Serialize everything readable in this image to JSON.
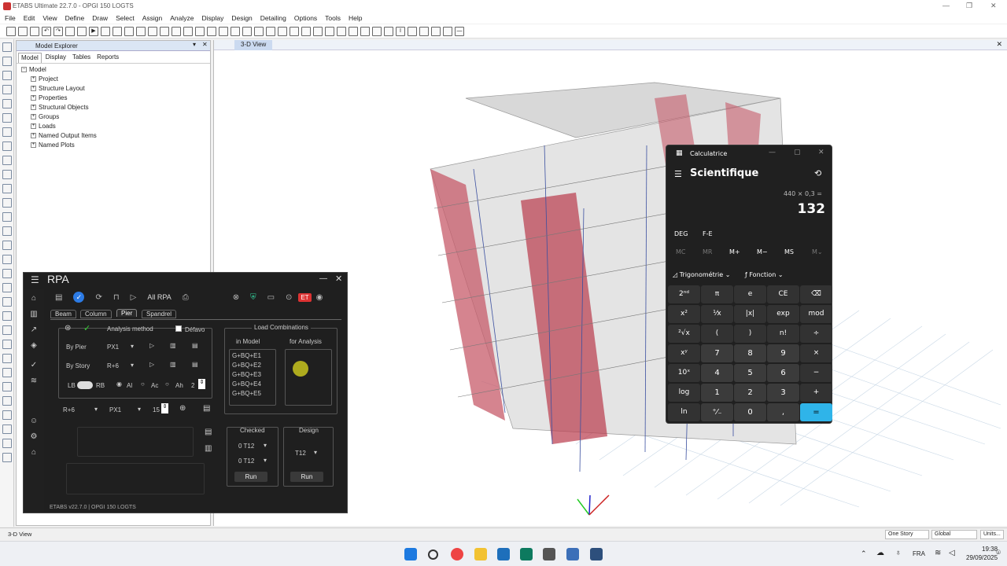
{
  "window": {
    "title": "ETABS Ultimate 22.7.0 - OPGI 150 LOGTS"
  },
  "menu": [
    "File",
    "Edit",
    "View",
    "Define",
    "Draw",
    "Select",
    "Assign",
    "Analyze",
    "Display",
    "Design",
    "Detailing",
    "Options",
    "Tools",
    "Help"
  ],
  "explorer": {
    "title": "Model Explorer",
    "tabs": [
      "Model",
      "Display",
      "Tables",
      "Reports"
    ],
    "root": "Model",
    "items": [
      "Project",
      "Structure Layout",
      "Properties",
      "Structural Objects",
      "Groups",
      "Loads",
      "Named Output Items",
      "Named Plots"
    ]
  },
  "viewport": {
    "tab": "3-D View"
  },
  "status": {
    "left": "3-D View",
    "story": "One Story",
    "coord": "Global",
    "units": "Units..."
  },
  "taskbar": {
    "lang": "FRA",
    "time": "19:38",
    "date": "29/09/2025"
  },
  "rpa": {
    "title": "RPA",
    "all_rpa": "All RPA",
    "et_badge": "ET",
    "tabs": [
      "Beam",
      "Column",
      "Pier",
      "Spandrel"
    ],
    "analysis_method": "Analysis method",
    "default_label": "Défavo",
    "by_pier": "By Pier",
    "by_pier_val": "PX1",
    "by_story": "By Story",
    "by_story_val": "R+6",
    "lb": "LB",
    "rb": "RB",
    "al": "Al",
    "ac": "Ac",
    "ah": "Ah",
    "ah_val": "2",
    "sel_story": "R+6",
    "sel_pier": "PX1",
    "sel_num": "15",
    "load_combinations": "Load Combinations",
    "in_model": "in Model",
    "for_analysis": "for Analysis",
    "combos": [
      "G+BQ+E1",
      "G+BQ+E2",
      "G+BQ+E3",
      "G+BQ+E4",
      "G+BQ+E5"
    ],
    "checked": "Checked",
    "checked_val1": "0 T12",
    "checked_val2": "0 T12",
    "design": "Design",
    "design_val": "T12",
    "run": "Run",
    "footer": "ETABS v22.7.0 | OPGI 150 LOGTS"
  },
  "calc": {
    "app": "Calculatrice",
    "mode": "Scientifique",
    "expression": "440 × 0,3 =",
    "result": "132",
    "deg": "DEG",
    "fe": "F-E",
    "memory": [
      "MC",
      "MR",
      "M+",
      "M−",
      "MS",
      "M⌄"
    ],
    "trig": "Trigonométrie",
    "func": "Fonction",
    "keys": [
      [
        "2ⁿᵈ",
        "π",
        "e",
        "CE",
        "⌫"
      ],
      [
        "x²",
        "¹⁄x",
        "|x|",
        "exp",
        "mod"
      ],
      [
        "²√x",
        "(",
        ")",
        "n!",
        "÷"
      ],
      [
        "xʸ",
        "7",
        "8",
        "9",
        "×"
      ],
      [
        "10ˣ",
        "4",
        "5",
        "6",
        "−"
      ],
      [
        "log",
        "1",
        "2",
        "3",
        "+"
      ],
      [
        "ln",
        "⁺⁄₋",
        "0",
        ",",
        "="
      ]
    ]
  }
}
